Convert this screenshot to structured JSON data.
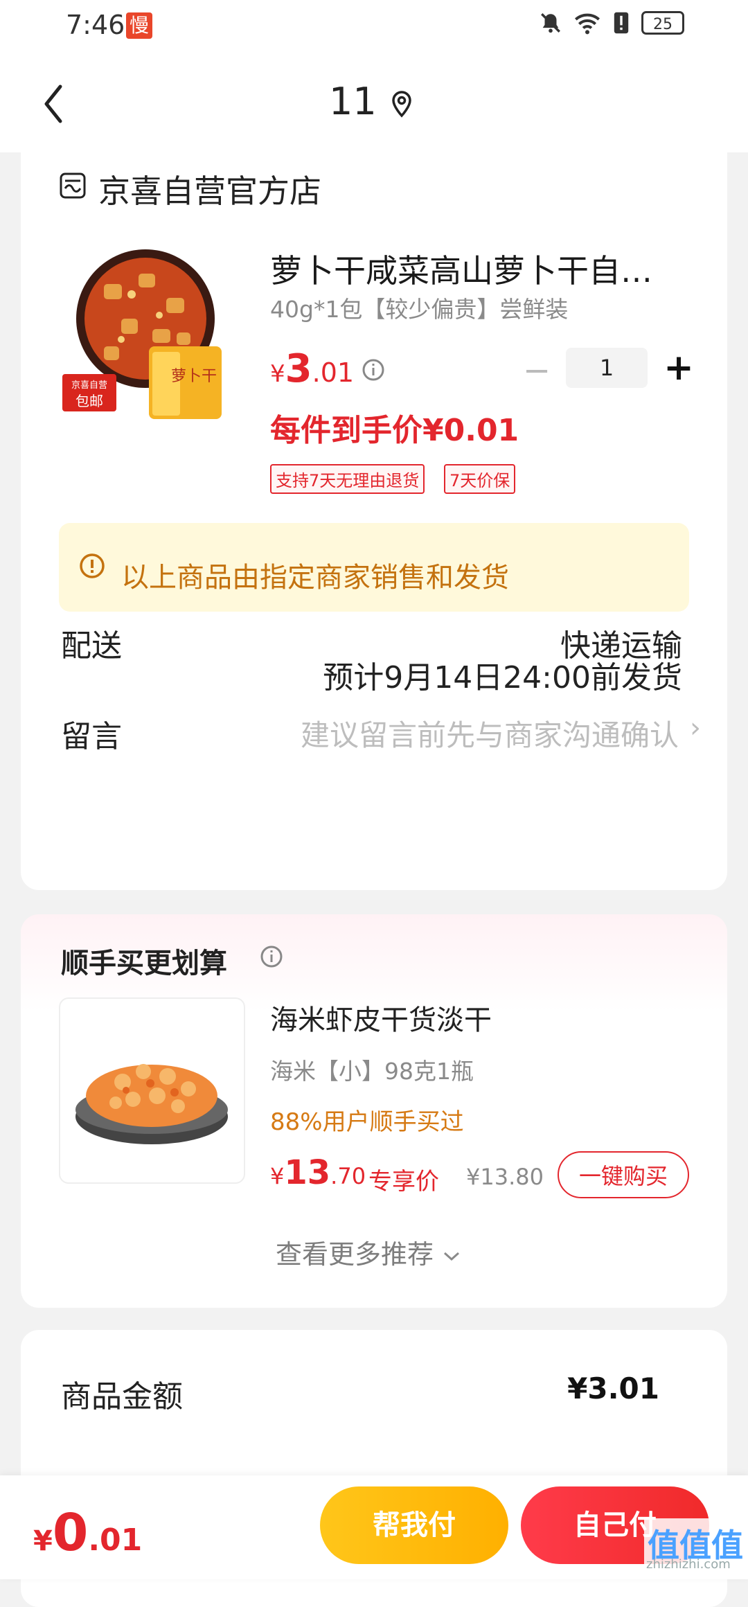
{
  "status_bar": {
    "time": "7:46",
    "slow_badge": "慢",
    "battery": "25"
  },
  "header": {
    "title": "11"
  },
  "store": {
    "name": "京喜自营官方店"
  },
  "product": {
    "title": "萝卜干咸菜高山萝卜干自…",
    "spec": "40g*1包【较少偏贵】尝鲜装",
    "price_symbol": "¥",
    "price_int": "3",
    "price_dec": ".01",
    "quantity": "1",
    "hand_price": "每件到手价¥0.01",
    "tags": [
      "支持7天无理由退货",
      "7天价保"
    ],
    "image_badge_line1": "京喜自营",
    "image_badge_line2": "包邮",
    "package_text": "萝卜干"
  },
  "notice": {
    "text": "以上商品由指定商家销售和发货"
  },
  "delivery": {
    "label": "配送",
    "method": "快递运输",
    "eta": "预计9月14日24:00前发货"
  },
  "message": {
    "label": "留言",
    "placeholder": "建议留言前先与商家沟通确认"
  },
  "recommend": {
    "title": "顺手买更划算",
    "name": "海米虾皮干货淡干",
    "spec": "海米【小】98克1瓶",
    "social": "88%用户顺手买过",
    "price_symbol": "¥",
    "price_int": "13",
    "price_dec": ".70",
    "price_label": "专享价",
    "orig_price": "¥13.80",
    "buy_label": "一键购买",
    "more_label": "查看更多推荐"
  },
  "summary": {
    "amount_label": "商品金额",
    "amount_value": "¥3.01"
  },
  "bottom": {
    "price_symbol": "¥",
    "price_int": "0",
    "price_dec": ".01",
    "help_pay": "帮我付",
    "self_pay": "自己付"
  },
  "watermark": {
    "text": "值值值",
    "sub": "zhizhizhi.com"
  },
  "colors": {
    "accent_red": "#e3262d",
    "notice_bg": "#fff9db",
    "notice_text": "#c4720f",
    "help_pay": "#ffb000",
    "self_pay": "#f02a2a"
  }
}
